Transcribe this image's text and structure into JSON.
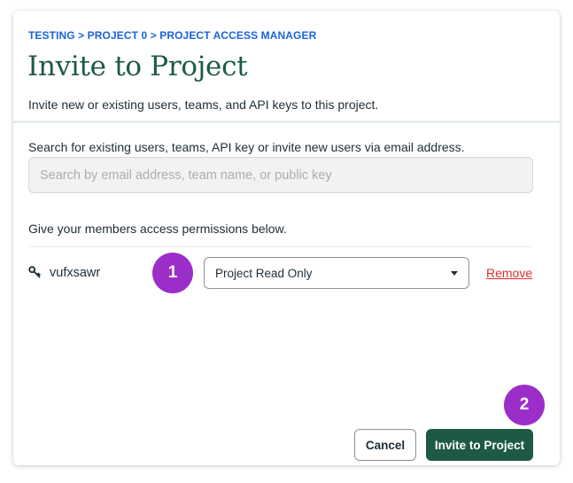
{
  "breadcrumb": "TESTING > PROJECT 0 > PROJECT ACCESS MANAGER",
  "header": {
    "title": "Invite to Project",
    "subtitle": "Invite new or existing users, teams, and API keys to this project."
  },
  "search": {
    "label": "Search for existing users, teams, API key or invite new users via email address.",
    "value": "",
    "placeholder": "Search by email address, team name, or public key"
  },
  "permissions": {
    "label": "Give your members access permissions below.",
    "members": [
      {
        "icon": "key-icon",
        "name": "vufxsawr",
        "role": "Project Read Only",
        "remove_label": "Remove"
      }
    ]
  },
  "badges": [
    "1",
    "2"
  ],
  "footer": {
    "cancel_label": "Cancel",
    "invite_label": "Invite to Project"
  },
  "colors": {
    "accent_green": "#1e5a43",
    "breadcrumb_blue": "#1a63d9",
    "remove_red": "#db3030",
    "badge_purple": "#9b2ec9"
  }
}
